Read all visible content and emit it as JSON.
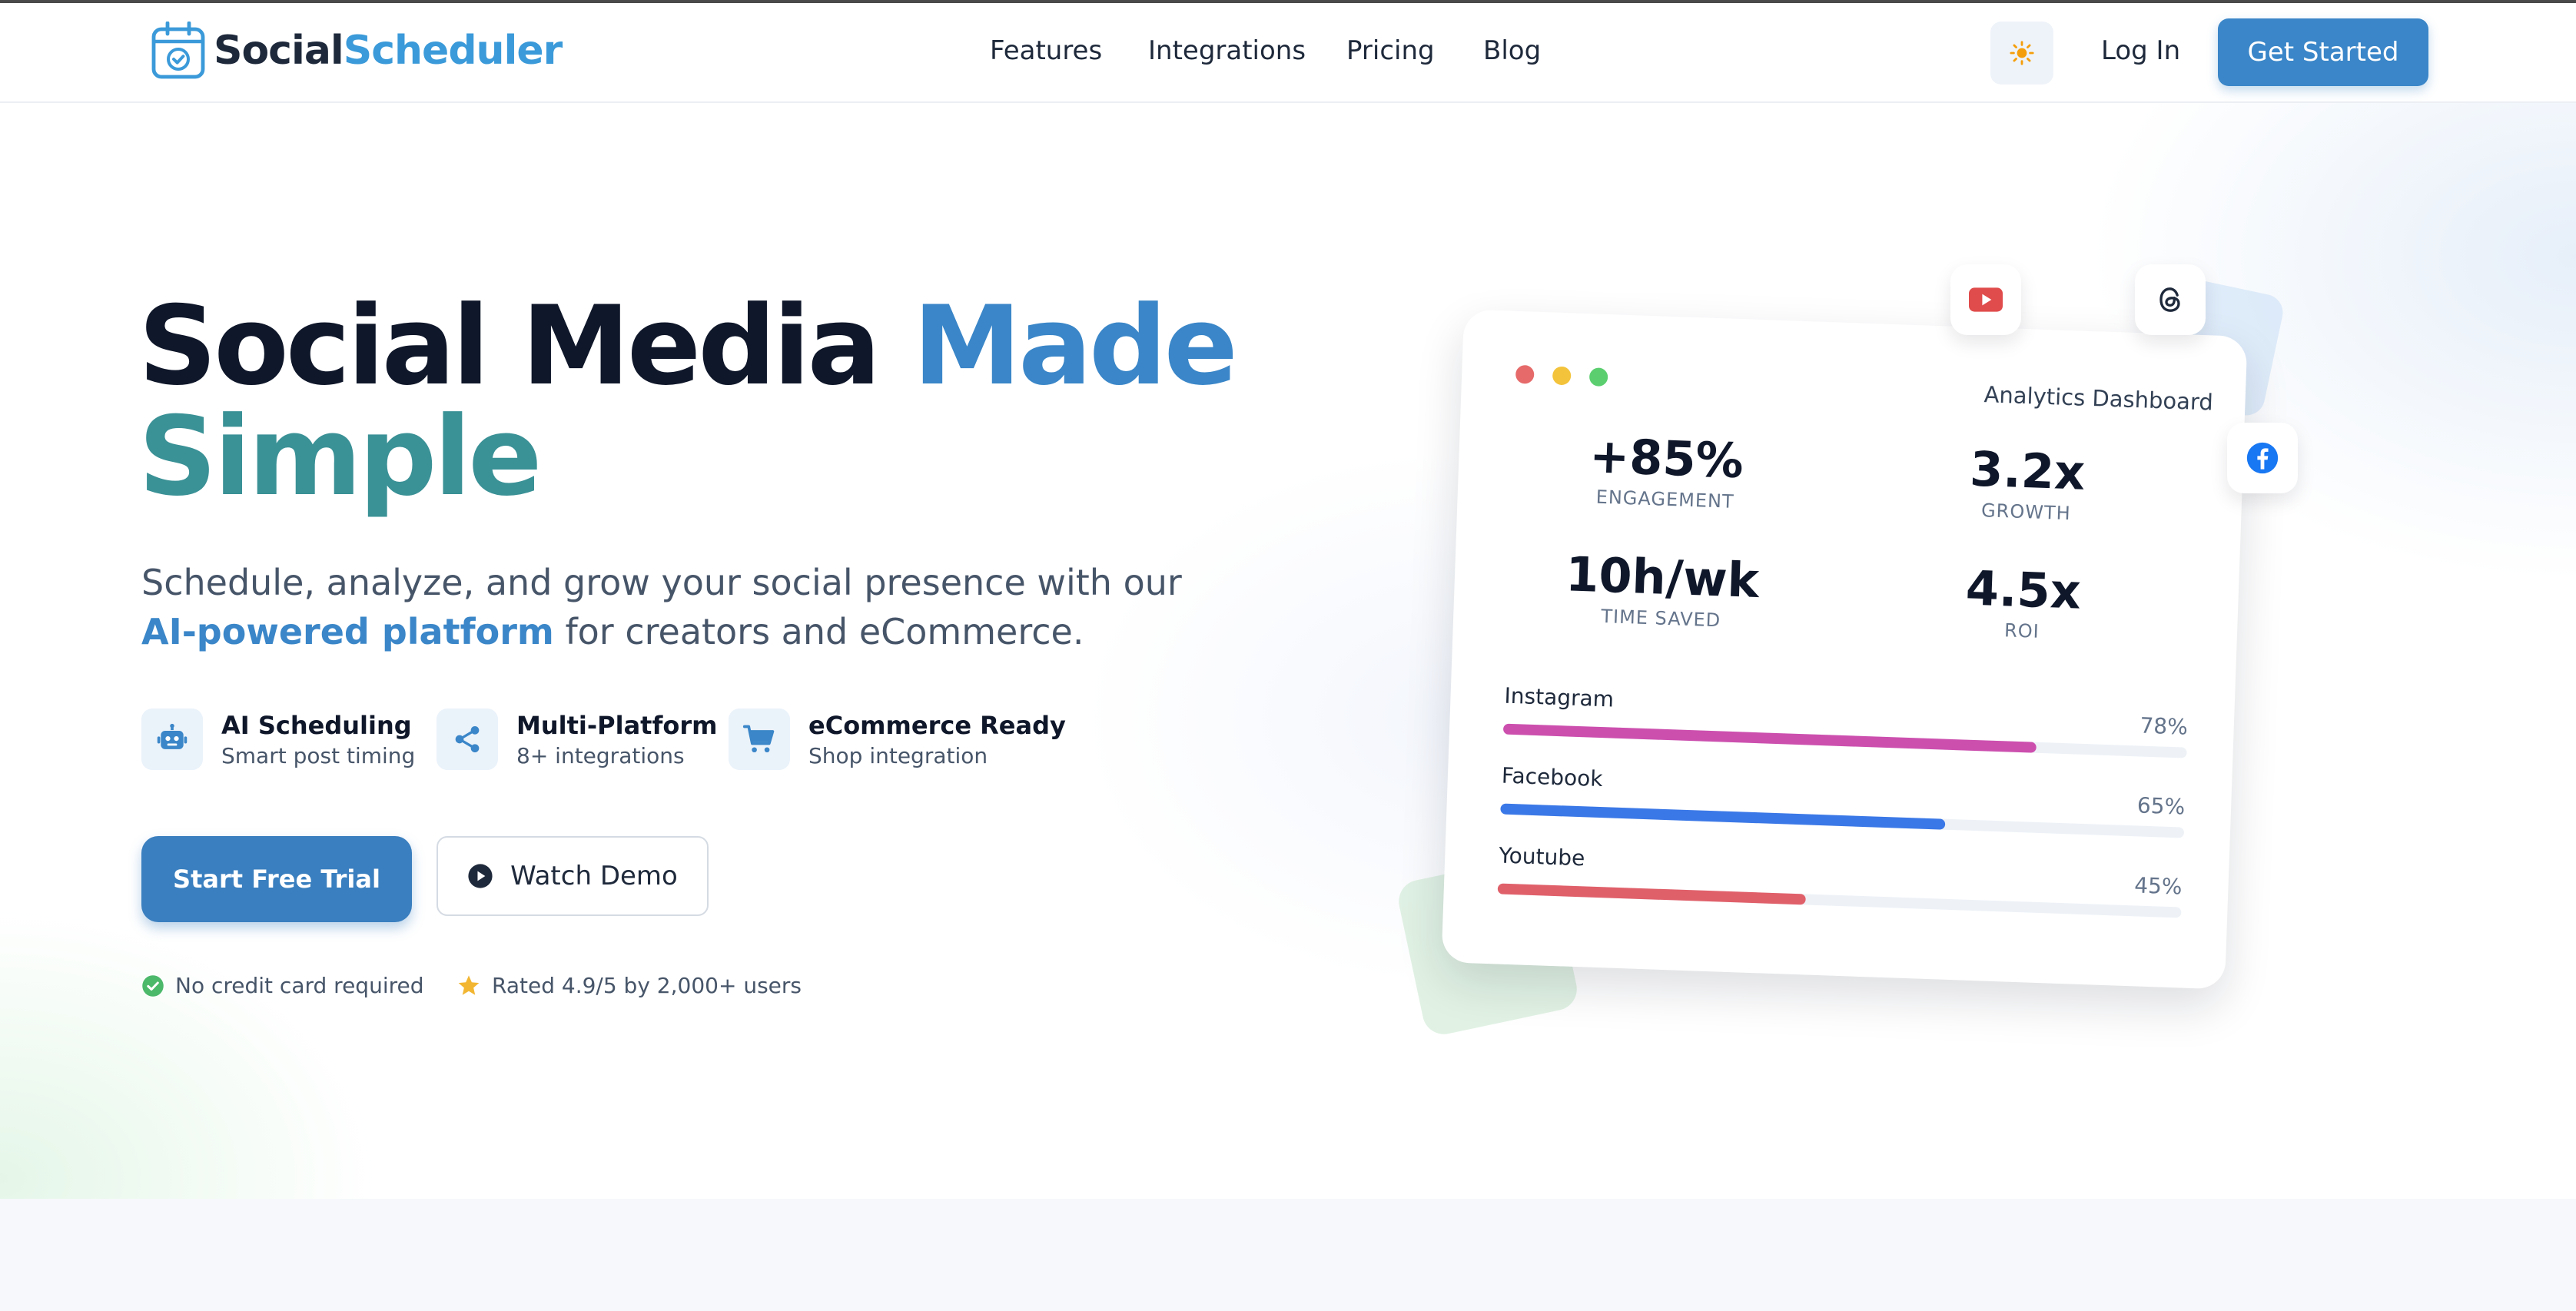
{
  "brand": {
    "part1": "Social",
    "part2": "Scheduler"
  },
  "nav": {
    "items": [
      "Features",
      "Integrations",
      "Pricing",
      "Blog"
    ],
    "login": "Log In",
    "cta": "Get Started"
  },
  "hero": {
    "title_dark": "Social Media",
    "title_blue": "Made",
    "title_teal": "Simple",
    "subtitle_1": "Schedule, analyze, and grow your social presence with our",
    "subtitle_highlight": "AI-powered platform",
    "subtitle_2": "for creators and eCommerce.",
    "features": [
      {
        "title": "AI Scheduling",
        "subtitle": "Smart post timing",
        "icon": "robot-icon"
      },
      {
        "title": "Multi-Platform",
        "subtitle": "8+ integrations",
        "icon": "share-icon"
      },
      {
        "title": "eCommerce Ready",
        "subtitle": "Shop integration",
        "icon": "cart-icon"
      }
    ],
    "primary_cta": "Start Free Trial",
    "secondary_cta": "Watch Demo",
    "trust": [
      "No credit card required",
      "Rated 4.9/5 by 2,000+ users"
    ]
  },
  "dashboard": {
    "title": "Analytics Dashboard",
    "metrics": [
      {
        "value": "+85%",
        "label": "ENGAGEMENT"
      },
      {
        "value": "3.2x",
        "label": "GROWTH"
      },
      {
        "value": "10h/wk",
        "label": "TIME SAVED"
      },
      {
        "value": "4.5x",
        "label": "ROI"
      }
    ],
    "bars": [
      {
        "name": "Instagram",
        "pct_label": "78%",
        "value": 0.78,
        "color": "#cc4fae"
      },
      {
        "name": "Facebook",
        "pct_label": "65%",
        "value": 0.65,
        "color": "#3b78e7"
      },
      {
        "name": "Youtube",
        "pct_label": "45%",
        "value": 0.45,
        "color": "#e0606a"
      }
    ],
    "floating_icons": [
      "youtube-icon",
      "threads-icon",
      "facebook-icon"
    ]
  },
  "colors": {
    "accent": "#3a86c8",
    "teal": "#3a9196",
    "dark": "#0f172a"
  }
}
